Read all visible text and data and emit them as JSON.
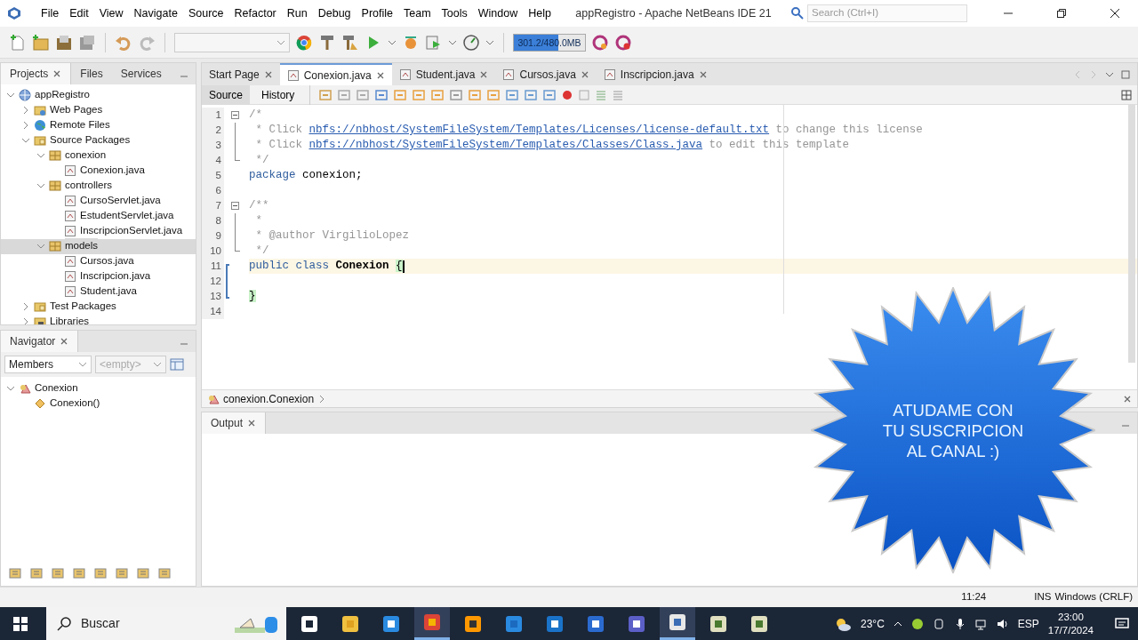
{
  "menu_bar": {
    "items": [
      "File",
      "Edit",
      "View",
      "Navigate",
      "Source",
      "Refactor",
      "Run",
      "Debug",
      "Profile",
      "Team",
      "Tools",
      "Window",
      "Help"
    ]
  },
  "window": {
    "title": "appRegistro - Apache NetBeans IDE 21"
  },
  "search": {
    "placeholder": "Search (Ctrl+I)"
  },
  "toolbar": {
    "memory": {
      "reading": "301.2/480.0MB",
      "level": 0.63
    }
  },
  "projects_panel": {
    "tabs": [
      {
        "label": "Projects",
        "selected": true,
        "closable": true
      },
      {
        "label": "Files",
        "selected": false,
        "closable": false
      },
      {
        "label": "Services",
        "selected": false,
        "closable": false
      }
    ],
    "tree": [
      {
        "label": "appRegistro",
        "kind": "project",
        "expanded": true,
        "selected": false,
        "children": [
          {
            "label": "Web Pages",
            "kind": "web",
            "expanded": false,
            "selected": false
          },
          {
            "label": "Remote Files",
            "kind": "remote",
            "expanded": false,
            "selected": false
          },
          {
            "label": "Source Packages",
            "kind": "folder",
            "expanded": true,
            "selected": false,
            "children": [
              {
                "label": "conexion",
                "kind": "package",
                "expanded": true,
                "selected": false,
                "children": [
                  {
                    "label": "Conexion.java",
                    "kind": "java",
                    "selected": false
                  }
                ]
              },
              {
                "label": "controllers",
                "kind": "package",
                "expanded": true,
                "selected": false,
                "children": [
                  {
                    "label": "CursoServlet.java",
                    "kind": "java",
                    "selected": false
                  },
                  {
                    "label": "EstudentServlet.java",
                    "kind": "java",
                    "selected": false
                  },
                  {
                    "label": "InscripcionServlet.java",
                    "kind": "java",
                    "selected": false
                  }
                ]
              },
              {
                "label": "models",
                "kind": "package",
                "expanded": true,
                "selected": true,
                "children": [
                  {
                    "label": "Cursos.java",
                    "kind": "java",
                    "selected": false
                  },
                  {
                    "label": "Inscripcion.java",
                    "kind": "java",
                    "selected": false
                  },
                  {
                    "label": "Student.java",
                    "kind": "java",
                    "selected": false
                  }
                ]
              }
            ]
          },
          {
            "label": "Test Packages",
            "kind": "folder",
            "expanded": false,
            "selected": false
          },
          {
            "label": "Libraries",
            "kind": "library",
            "expanded": false,
            "selected": false
          }
        ]
      }
    ]
  },
  "navigator": {
    "title": "Navigator",
    "filters": [
      {
        "value": "Members",
        "disabled": false
      },
      {
        "value": "<empty>",
        "disabled": true
      }
    ],
    "tree": [
      {
        "label": "Conexion",
        "kind": "class",
        "expanded": true,
        "children": [
          {
            "label": "Conexion()",
            "kind": "constructor"
          }
        ]
      }
    ]
  },
  "editor": {
    "tabs": [
      {
        "label": "Start Page",
        "kind": "page",
        "selected": false
      },
      {
        "label": "Conexion.java",
        "kind": "java",
        "selected": true
      },
      {
        "label": "Student.java",
        "kind": "java",
        "selected": false
      },
      {
        "label": "Cursos.java",
        "kind": "java",
        "selected": false
      },
      {
        "label": "Inscripcion.java",
        "kind": "java",
        "selected": false
      }
    ],
    "views": [
      {
        "label": "Source",
        "selected": true
      },
      {
        "label": "History",
        "selected": false
      }
    ],
    "lines": [
      {
        "number": "1",
        "fold": {
          "kind": "start"
        },
        "tokens": [
          {
            "kind": "comment",
            "text": "/*"
          }
        ]
      },
      {
        "number": "2",
        "fold": {
          "kind": "line"
        },
        "tokens": [
          {
            "kind": "comment",
            "text": " * Click "
          },
          {
            "kind": "link",
            "text": "nbfs://nbhost/SystemFileSystem/Templates/Licenses/license-default.txt"
          },
          {
            "kind": "comment",
            "text": " to change this license"
          }
        ]
      },
      {
        "number": "3",
        "fold": {
          "kind": "line"
        },
        "tokens": [
          {
            "kind": "comment",
            "text": " * Click "
          },
          {
            "kind": "link",
            "text": "nbfs://nbhost/SystemFileSystem/Templates/Classes/Class.java"
          },
          {
            "kind": "comment",
            "text": " to edit this template"
          }
        ]
      },
      {
        "number": "4",
        "fold": {
          "kind": "end"
        },
        "tokens": [
          {
            "kind": "comment",
            "text": " */"
          }
        ]
      },
      {
        "number": "5",
        "tokens": [
          {
            "kind": "keyword",
            "text": "package"
          },
          {
            "kind": "plain",
            "text": " conexion;"
          }
        ]
      },
      {
        "number": "6"
      },
      {
        "number": "7",
        "fold": {
          "kind": "start"
        },
        "tokens": [
          {
            "kind": "comment",
            "text": "/**"
          }
        ]
      },
      {
        "number": "8",
        "fold": {
          "kind": "line"
        },
        "tokens": [
          {
            "kind": "comment",
            "text": " *"
          }
        ]
      },
      {
        "number": "9",
        "fold": {
          "kind": "line"
        },
        "tokens": [
          {
            "kind": "comment",
            "text": " * @author VirgilioLopez"
          }
        ]
      },
      {
        "number": "10",
        "fold": {
          "kind": "end"
        },
        "tokens": [
          {
            "kind": "comment",
            "text": " */"
          }
        ]
      },
      {
        "number": "11",
        "current": true,
        "scope": {
          "kind": "start"
        },
        "tokens": [
          {
            "kind": "keyword",
            "text": "public class"
          },
          {
            "kind": "classname",
            "text": "Conexion"
          },
          {
            "kind": "match",
            "text": "{"
          }
        ]
      },
      {
        "number": "12",
        "scope": {
          "kind": "line"
        }
      },
      {
        "number": "13",
        "scope": {
          "kind": "end"
        },
        "tokens": [
          {
            "kind": "match",
            "text": "}"
          }
        ]
      },
      {
        "number": "14"
      }
    ],
    "breadcrumb": "conexion.Conexion"
  },
  "output_panel": {
    "tab": "Output"
  },
  "status_bar": {
    "position": "11:24",
    "mode": "INS",
    "line_ending": "Windows (CRLF)"
  },
  "taskbar": {
    "search_placeholder": "Buscar",
    "apps": [
      {
        "kind": "taskview",
        "running": false
      },
      {
        "kind": "explorer",
        "running": false
      },
      {
        "kind": "store",
        "running": false
      },
      {
        "kind": "chrome",
        "running": true
      },
      {
        "kind": "sublime",
        "running": false
      },
      {
        "kind": "vscode",
        "running": false
      },
      {
        "kind": "outlook",
        "running": false
      },
      {
        "kind": "word",
        "running": false
      },
      {
        "kind": "teams",
        "running": false
      },
      {
        "kind": "netbeans",
        "running": true
      },
      {
        "kind": "app",
        "running": false
      },
      {
        "kind": "app",
        "running": false
      }
    ],
    "weather": "23°C",
    "language": "ESP",
    "time": "23:00",
    "date": "17/7/2024"
  },
  "promo_badge": {
    "text": "ATUDAME CON\nTU SUSCRIPCION\nAL CANAL :)"
  }
}
